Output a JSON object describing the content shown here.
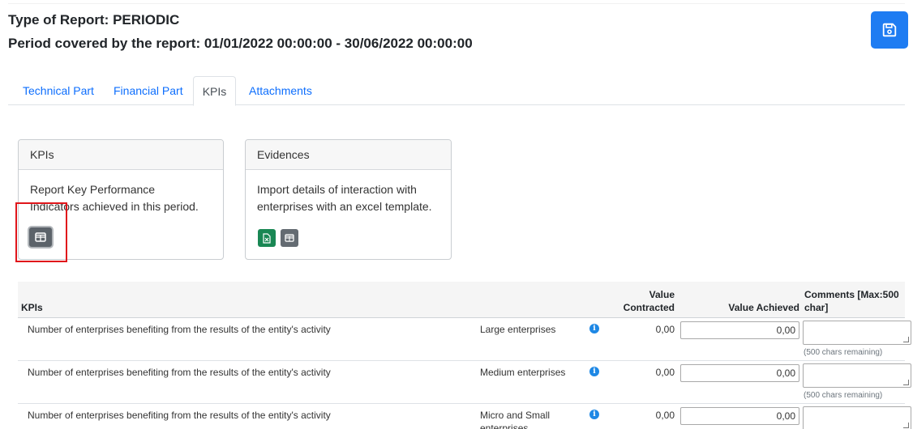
{
  "header": {
    "report_type": "Type of Report: PERIODIC",
    "period": "Period covered by the report: 01/01/2022 00:00:00 - 30/06/2022 00:00:00"
  },
  "toolbar": {
    "save_icon": "floppy-disk-icon"
  },
  "tabs": [
    {
      "label": "Technical Part"
    },
    {
      "label": "Financial Part"
    },
    {
      "label": "KPIs",
      "active": true
    },
    {
      "label": "Attachments"
    }
  ],
  "cards": {
    "kpis": {
      "title": "KPIs",
      "text": "Report Key Performance Indicators achieved in this period.",
      "button_icon": "table-icon"
    },
    "evidences": {
      "title": "Evidences",
      "text": "Import details of interaction with enterprises with an excel template.",
      "excel_icon": "excel-file-icon",
      "table_icon": "table-icon"
    }
  },
  "table": {
    "headers": {
      "kpis": "KPIs",
      "value_contracted_1": "Value",
      "value_contracted_2": "Contracted",
      "value_achieved": "Value Achieved",
      "comments_1": "Comments [Max:500",
      "comments_2": "char]"
    },
    "rows": [
      {
        "kpi": "Number of enterprises benefiting from the results of the entity's activity",
        "category": "Large enterprises",
        "category_2": "",
        "contracted": "0,00",
        "achieved": "0,00",
        "chars_remaining": "(500 chars remaining)"
      },
      {
        "kpi": "Number of enterprises benefiting from the results of the entity's activity",
        "category": "Medium enterprises",
        "category_2": "",
        "contracted": "0,00",
        "achieved": "0,00",
        "chars_remaining": "(500 chars remaining)"
      },
      {
        "kpi": "Number of enterprises benefiting from the results of the entity's activity",
        "category": "Micro and Small",
        "category_2": "enterprises",
        "contracted": "0,00",
        "achieved": "0,00",
        "chars_remaining": ""
      }
    ]
  },
  "colors": {
    "primary": "#1e7cf2",
    "link": "#0d6efd",
    "highlight": "#e0161b",
    "excel_green": "#198754",
    "info_blue": "#1e88e5"
  }
}
